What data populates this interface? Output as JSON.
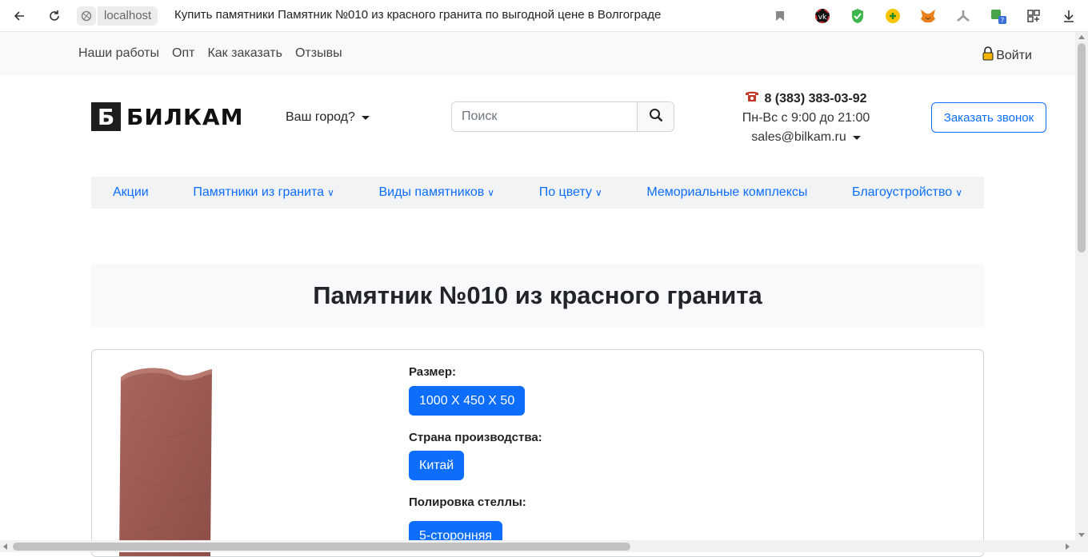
{
  "browser": {
    "host": "localhost",
    "tab_title": "Купить памятники Памятник №010 из красного гранита по выгодной цене в Волгограде"
  },
  "topbar": {
    "links": [
      "Наши работы",
      "Опт",
      "Как заказать",
      "Отзывы"
    ],
    "login": "Войти"
  },
  "header": {
    "logo_letter": "Б",
    "logo_text": "БИЛКАМ",
    "city_label": "Ваш город?",
    "search_placeholder": "Поиск",
    "phone": "8 (383) 383-03-92",
    "hours": "Пн-Вс с 9:00 до 21:00",
    "email": "sales@bilkam.ru",
    "call_button": "Заказать звонок"
  },
  "menu": {
    "items": [
      {
        "label": "Акции",
        "has_dropdown": false
      },
      {
        "label": "Памятники из гранита",
        "has_dropdown": true
      },
      {
        "label": "Виды памятников",
        "has_dropdown": true
      },
      {
        "label": "По цвету",
        "has_dropdown": true
      },
      {
        "label": "Мемориальные комплексы",
        "has_dropdown": false
      },
      {
        "label": "Благоустройство",
        "has_dropdown": true
      }
    ],
    "chevron": "∨"
  },
  "product": {
    "title": "Памятник №010 из красного гранита",
    "size_label": "Размер:",
    "size_value": "1000 X 450 X 50",
    "country_label": "Страна производства:",
    "country_value": "Китай",
    "polish_label": "Полировка стеллы:",
    "polish_value": "5-сторонняя"
  },
  "colors": {
    "accent": "#0d6efd",
    "stone": "#9a5a52"
  }
}
